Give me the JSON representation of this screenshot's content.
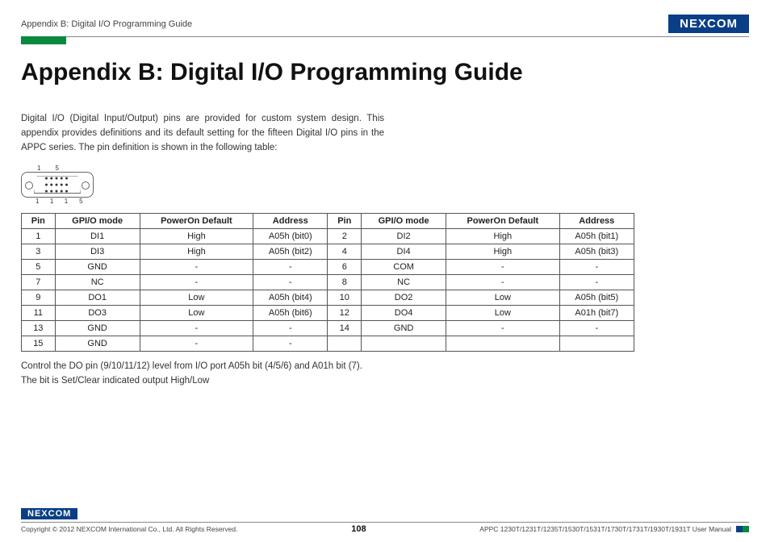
{
  "header": {
    "breadcrumb": "Appendix B: Digital I/O Programming Guide",
    "logo_text": "NE COM",
    "logo_x": "X"
  },
  "title": "Appendix B: Digital I/O Programming Guide",
  "intro": "Digital I/O (Digital Input/Output) pins are provided for custom system design. This appendix provides definitions and its default setting for the fifteen Digital I/O pins in the APPC series. The pin definition is shown in the following table:",
  "connector": {
    "top_left": "1",
    "top_right": "5",
    "bot_left": "11",
    "bot_right": "15"
  },
  "table": {
    "headers": [
      "Pin",
      "GPI/O mode",
      "PowerOn Default",
      "Address",
      "Pin",
      "GPI/O mode",
      "PowerOn Default",
      "Address"
    ],
    "rows": [
      [
        "1",
        "DI1",
        "High",
        "A05h (bit0)",
        "2",
        "DI2",
        "High",
        "A05h (bit1)"
      ],
      [
        "3",
        "DI3",
        "High",
        "A05h (bit2)",
        "4",
        "DI4",
        "High",
        "A05h (bit3)"
      ],
      [
        "5",
        "GND",
        "-",
        "-",
        "6",
        "COM",
        "-",
        "-"
      ],
      [
        "7",
        "NC",
        "-",
        "-",
        "8",
        "NC",
        "-",
        "-"
      ],
      [
        "9",
        "DO1",
        "Low",
        "A05h (bit4)",
        "10",
        "DO2",
        "Low",
        "A05h (bit5)"
      ],
      [
        "11",
        "DO3",
        "Low",
        "A05h (bit6)",
        "12",
        "DO4",
        "Low",
        "A01h (bit7)"
      ],
      [
        "13",
        "GND",
        "-",
        "-",
        "14",
        "GND",
        "-",
        "-"
      ],
      [
        "15",
        "GND",
        "-",
        "-",
        "",
        "",
        "",
        ""
      ]
    ]
  },
  "notes": {
    "line1": "Control the DO pin (9/10/11/12) level from I/O port A05h bit (4/5/6) and A01h bit (7).",
    "line2": "The bit is Set/Clear indicated output High/Low"
  },
  "footer": {
    "logo": "NE COM",
    "logo_x": "X",
    "copyright": "Copyright © 2012 NEXCOM International Co., Ltd. All Rights Reserved.",
    "page": "108",
    "manual": "APPC 1230T/1231T/1235T/1530T/1531T/1730T/1731T/1930T/1931T User Manual"
  }
}
